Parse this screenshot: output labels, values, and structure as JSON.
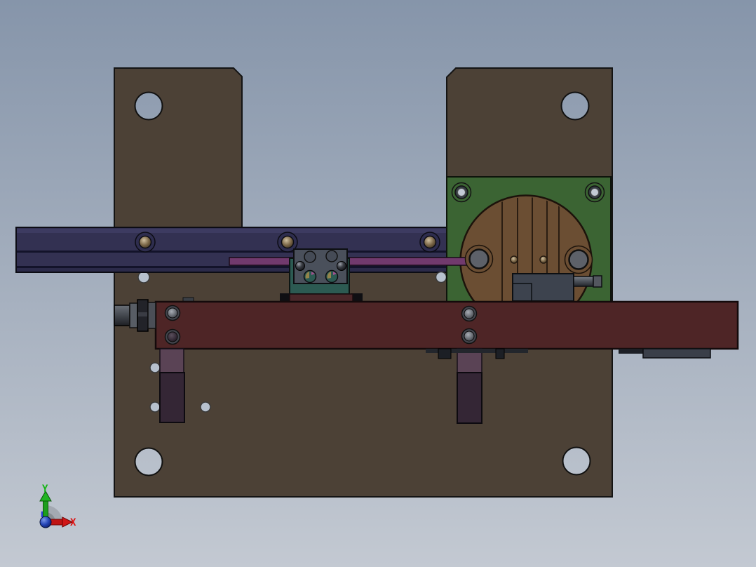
{
  "viewport": {
    "description": "cad-assembly-front-view"
  },
  "colors": {
    "bg_top": "#8695aa",
    "bg_bottom": "#c3c9d2",
    "plate": "#4c4136",
    "rail": "#333152",
    "rail_light": "#3d3b61",
    "rod": "#713a6d",
    "green_plate": "#3b6433",
    "disc": "#6b4e33",
    "bar": "#4e2526",
    "bar_strip": "#4a2629",
    "teal": "#2c5a52",
    "carriage": "#4a505b",
    "motor": "#3d434e",
    "post_top": "#5a4355",
    "post_bottom": "#342635",
    "hole_small": "#b7c1ce",
    "hub": "#5d6169",
    "axis_x": "#dd1111",
    "axis_y": "#15b515"
  },
  "triad": {
    "x_label": "X",
    "y_label": "Y"
  }
}
